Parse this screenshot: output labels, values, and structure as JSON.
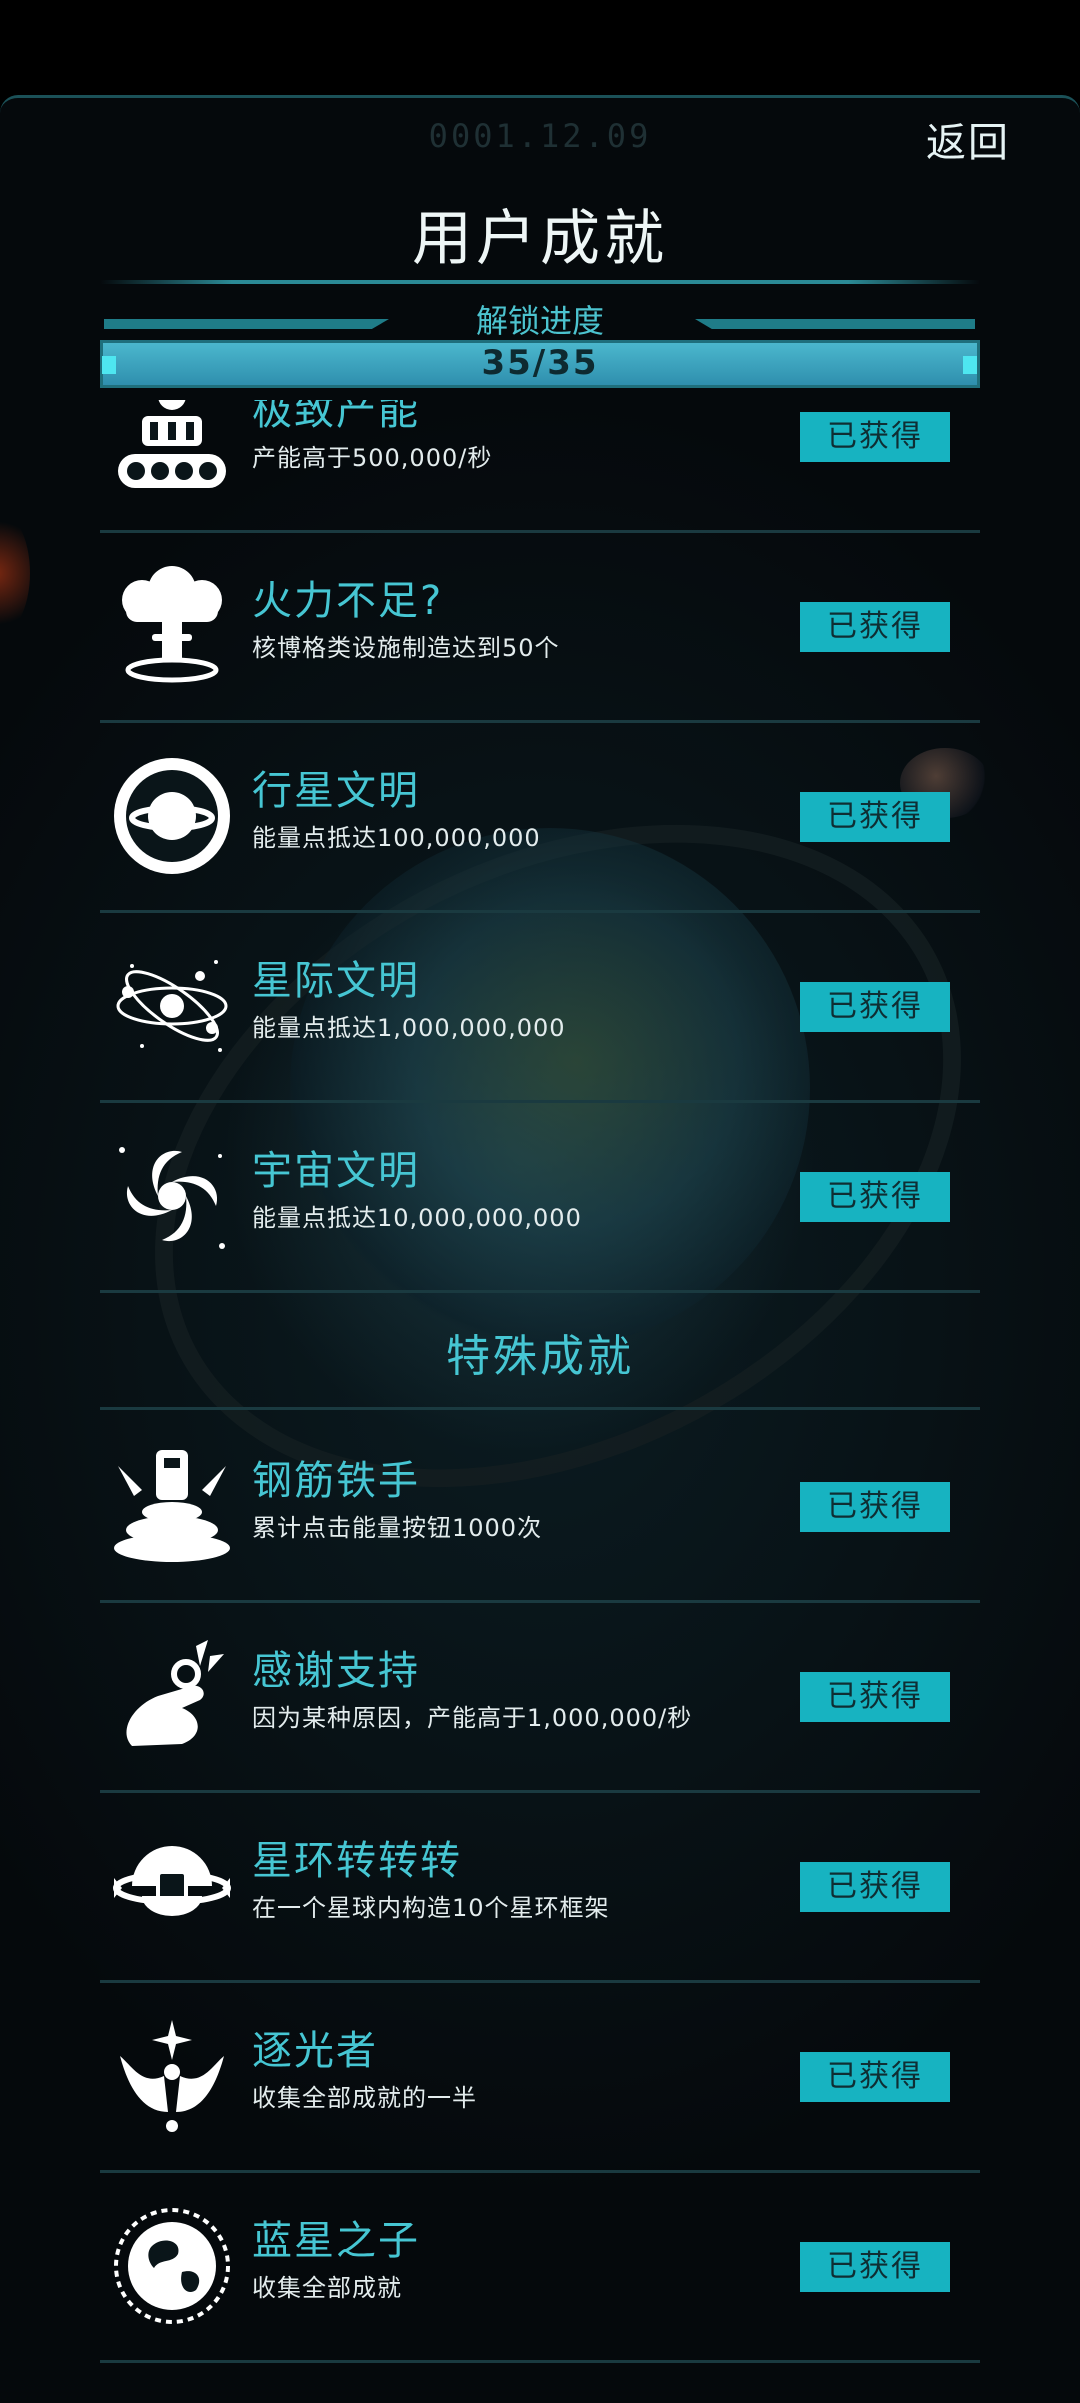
{
  "header": {
    "date": "0001.12.09",
    "back_label": "返回",
    "title": "用户成就",
    "progress_label": "解锁进度",
    "progress_text": "35/35",
    "progress_fraction": 1.0
  },
  "section_special": "特殊成就",
  "achievements": [
    {
      "name": "极致产能",
      "desc": "产能高于500,000/秒",
      "status": "已获得",
      "icon": "factory-robot-icon"
    },
    {
      "name": "火力不足?",
      "desc": "核博格类设施制造达到50个",
      "status": "已获得",
      "icon": "mushroom-cloud-icon"
    },
    {
      "name": "行星文明",
      "desc": "能量点抵达100,000,000",
      "status": "已获得",
      "icon": "planet-ring-icon"
    },
    {
      "name": "星际文明",
      "desc": "能量点抵达1,000,000,000",
      "status": "已获得",
      "icon": "atom-orbit-icon"
    },
    {
      "name": "宇宙文明",
      "desc": "能量点抵达10,000,000,000",
      "status": "已获得",
      "icon": "galaxy-spiral-icon"
    },
    {
      "name": "钢筋铁手",
      "desc": "累计点击能量按钮1000次",
      "status": "已获得",
      "icon": "press-button-icon"
    },
    {
      "name": "感谢支持",
      "desc": "因为某种原因，产能高于1,000,000/秒",
      "status": "已获得",
      "icon": "ok-hand-icon"
    },
    {
      "name": "星环转转转",
      "desc": "在一个星球内构造10个星环框架",
      "status": "已获得",
      "icon": "ring-frame-icon"
    },
    {
      "name": "逐光者",
      "desc": "收集全部成就的一半",
      "status": "已获得",
      "icon": "winged-star-icon"
    },
    {
      "name": "蓝星之子",
      "desc": "收集全部成就",
      "status": "已获得",
      "icon": "earth-emblem-icon"
    }
  ]
}
